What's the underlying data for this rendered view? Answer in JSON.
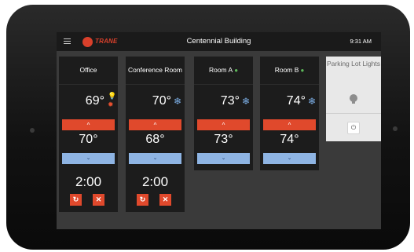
{
  "header": {
    "brand": "TRANE",
    "building": "Centennial Building",
    "time": "9:31 AM"
  },
  "rooms": [
    {
      "name": "Office",
      "current": "69°",
      "setpoint": "70°",
      "timer": "2:00",
      "status_icons": [
        "lightbulb-icon",
        "sun-heat-icon"
      ]
    },
    {
      "name": "Conference Room",
      "current": "70°",
      "setpoint": "68°",
      "timer": "2:00",
      "status_icons": [
        "snowflake-icon"
      ]
    },
    {
      "name": "Room A",
      "current": "73°",
      "setpoint": "73°",
      "status_icons": [
        "leaf-icon",
        "snowflake-icon"
      ]
    },
    {
      "name": "Room B",
      "current": "74°",
      "setpoint": "74°",
      "status_icons": [
        "leaf-icon",
        "snowflake-icon"
      ]
    }
  ],
  "parking": {
    "name": "Parking Lot Lights",
    "icons": [
      "lightbulb-icon",
      "power-icon"
    ]
  },
  "glyphs": {
    "up": "^",
    "down": "⌄",
    "snow": "❄",
    "leaf": "●",
    "bulb": "💡",
    "sun": "✹",
    "refresh": "↻",
    "cancel": "✕",
    "power": "⏻",
    "logo": "●"
  },
  "colors": {
    "brand_red": "#e0492c",
    "cool_blue": "#8eb4e3",
    "eco_green": "#5db85a",
    "card_bg": "#1c1c1c",
    "screen_bg": "#3a3a3a"
  }
}
